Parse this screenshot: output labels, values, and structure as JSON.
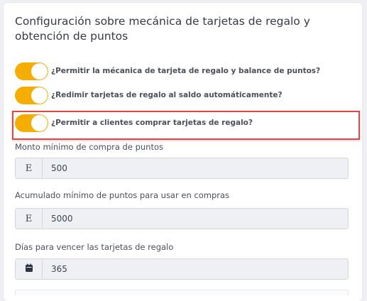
{
  "section": {
    "title": "Configuración sobre mecánica de tarjetas de regalo y obtención de puntos"
  },
  "toggles": [
    {
      "label": "¿Permitir la mécanica de tarjeta de regalo y balance de puntos?",
      "checked": true
    },
    {
      "label": "¿Redimir tarjetas de regalo al saldo automáticamente?",
      "checked": true
    },
    {
      "label": "¿Permitir a clientes comprar tarjetas de regalo?",
      "checked": true
    }
  ],
  "fields": [
    {
      "label": "Monto mínimo de compra de puntos",
      "addon": "E",
      "value": "500"
    },
    {
      "label": "Acumulado mínimo de puntos para usar en compras",
      "addon": "E",
      "value": "5000"
    },
    {
      "label": "Días para vencer las tarjetas de regalo",
      "addon_icon": "calendar-icon",
      "value": "365"
    }
  ],
  "colors": {
    "toggle_on": "#f5ad00",
    "highlight": "#e04848"
  }
}
